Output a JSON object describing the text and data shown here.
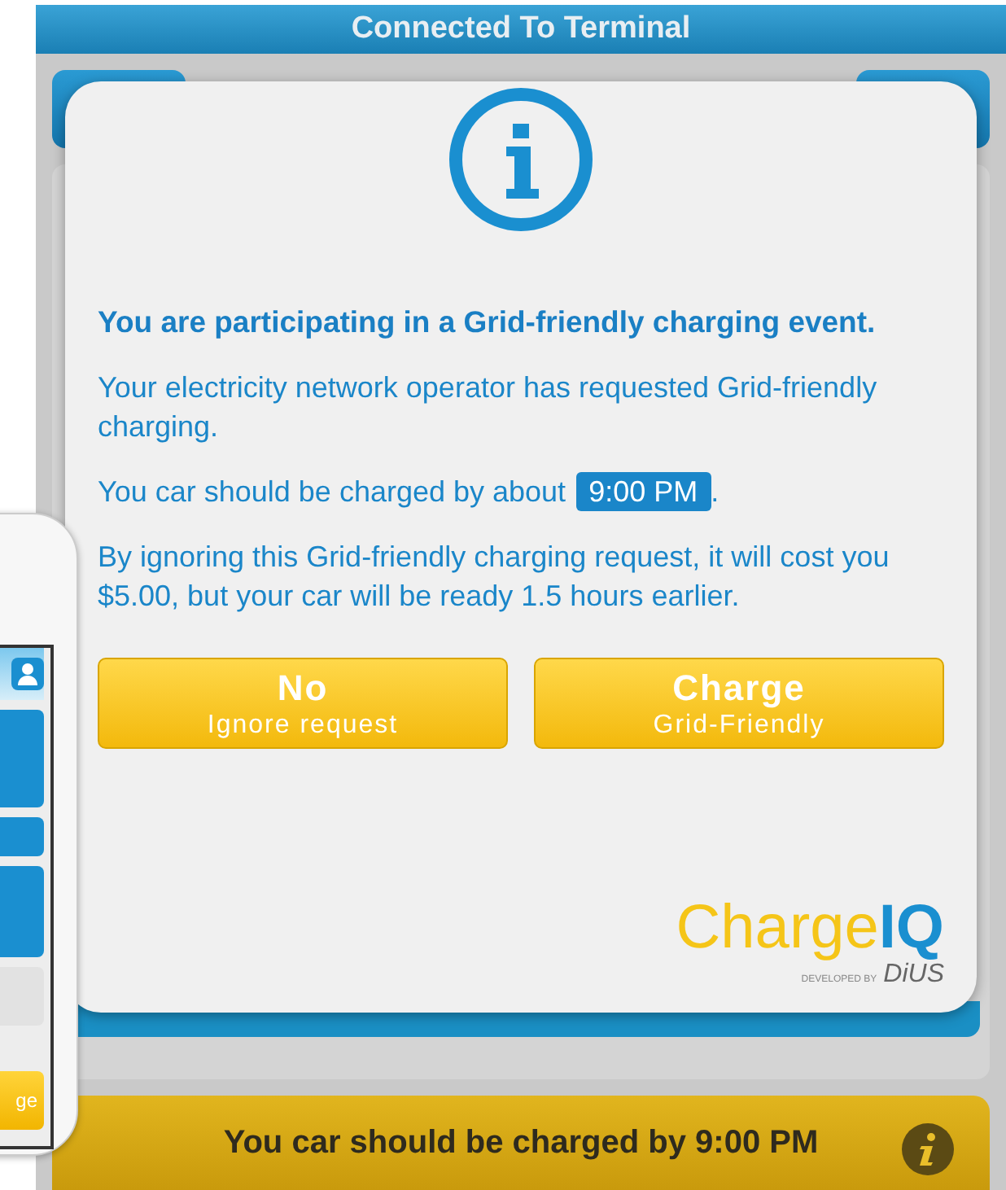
{
  "status_bar": {
    "title": "Connected To Terminal"
  },
  "dialog": {
    "heading": "You are participating in a Grid-friendly charging event.",
    "paragraphs": [
      {
        "kind": "plain",
        "text": "Your electricity network operator has requested Grid-friendly charging."
      },
      {
        "kind": "time",
        "before": "You car should be charged by about",
        "time": "9:00 PM",
        "after": "."
      },
      {
        "kind": "plain",
        "text": "By ignoring this Grid-friendly charging request, it will cost you $5.00, but your car will be ready 1.5 hours earlier."
      }
    ],
    "buttons": [
      {
        "title": "No",
        "subtitle": "Ignore request"
      },
      {
        "title": "Charge",
        "subtitle": "Grid-Friendly"
      }
    ],
    "logo": {
      "part_1": "Charge",
      "part_2": "IQ",
      "credit": "DEVELOPED BY",
      "maker": "DiUS"
    }
  },
  "footer_banner": {
    "text": "You car should be charged by 9:00 PM"
  },
  "side_phone": {
    "button_text": "ge"
  }
}
